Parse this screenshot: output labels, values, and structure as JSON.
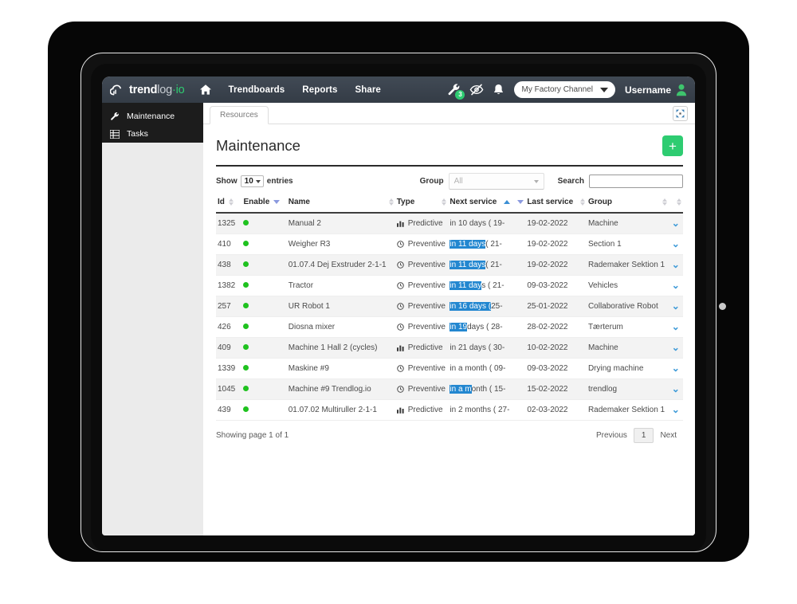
{
  "brand": {
    "logo_part1": "trend",
    "logo_part2": "log",
    "logo_part3": "·io",
    "accent_green": "#2ecc71",
    "navbar_bg": "#3e4651",
    "sidebar_bg": "#1c1c1c"
  },
  "navbar": {
    "home_icon": "home-icon",
    "links": [
      {
        "label": "Trendboards"
      },
      {
        "label": "Reports"
      },
      {
        "label": "Share"
      }
    ],
    "icons": [
      {
        "name": "wrench-icon",
        "badge": "3"
      },
      {
        "name": "eye-slash-icon",
        "badge": ""
      },
      {
        "name": "bell-icon",
        "badge": ""
      }
    ],
    "channel": {
      "label": "My Factory Channel",
      "caret": "chevron-down-icon"
    },
    "user": {
      "label": "Username",
      "icon": "user-icon"
    }
  },
  "sidebar": {
    "items": [
      {
        "label": "Maintenance",
        "icon": "wrench-icon"
      },
      {
        "label": "Tasks",
        "icon": "list-icon"
      }
    ]
  },
  "tabs": {
    "items": [
      {
        "label": "Resources",
        "active": true
      }
    ],
    "expand_icon": "expand-arrows-icon"
  },
  "page": {
    "title": "Maintenance",
    "add_button_label": "+"
  },
  "controls": {
    "show_label": "Show",
    "show_value": "10",
    "entries_label": "entries",
    "group_label": "Group",
    "group_value": "All",
    "search_label": "Search",
    "search_value": "",
    "search_placeholder": ""
  },
  "table": {
    "columns": [
      {
        "label": "Id",
        "sort": "neutral"
      },
      {
        "label": "Enable",
        "sort": "down-light"
      },
      {
        "label": "Name",
        "sort": "neutral"
      },
      {
        "label": "Type",
        "sort": "neutral"
      },
      {
        "label": "Next service",
        "sort": "up-active-down-light"
      },
      {
        "label": "Last service",
        "sort": "neutral"
      },
      {
        "label": "Group",
        "sort": "neutral"
      },
      {
        "label": "",
        "sort": "neutral"
      }
    ],
    "rows": [
      {
        "id": "1325",
        "enable": true,
        "name": "Manual 2",
        "type": "Predictive",
        "type_icon": "bar-chart-icon",
        "next_service": "in 10 days ( 19-",
        "sel_chars": 0,
        "last_service": "19-02-2022",
        "group": "Machine"
      },
      {
        "id": "410",
        "enable": true,
        "name": "Weigher R3",
        "type": "Preventive",
        "type_icon": "clock-icon",
        "next_service": "in 11 days ( 21-",
        "sel_chars": 10,
        "last_service": "19-02-2022",
        "group": "Section 1"
      },
      {
        "id": "438",
        "enable": true,
        "name": "01.07.4 Dej Exstruder 2-1-1",
        "type": "Preventive",
        "type_icon": "clock-icon",
        "next_service": "in 11 days ( 21-",
        "sel_chars": 10,
        "last_service": "19-02-2022",
        "group": "Rademaker Sektion 1"
      },
      {
        "id": "1382",
        "enable": true,
        "name": "Tractor",
        "type": "Preventive",
        "type_icon": "clock-icon",
        "next_service": "in 11 days ( 21-",
        "sel_chars": 9,
        "last_service": "09-03-2022",
        "group": "Vehicles"
      },
      {
        "id": "257",
        "enable": true,
        "name": "UR Robot 1",
        "type": "Preventive",
        "type_icon": "clock-icon",
        "next_service": "in 16 days ( 25-",
        "sel_chars": 12,
        "last_service": "25-01-2022",
        "group": "Collaborative Robot"
      },
      {
        "id": "426",
        "enable": true,
        "name": "Diosna mixer",
        "type": "Preventive",
        "type_icon": "clock-icon",
        "next_service": "in 19 days ( 28-",
        "sel_chars": 5,
        "last_service": "28-02-2022",
        "group": "Tærterum"
      },
      {
        "id": "409",
        "enable": true,
        "name": "Machine 1 Hall 2 (cycles)",
        "type": "Predictive",
        "type_icon": "bar-chart-icon",
        "next_service": "in 21 days ( 30-",
        "sel_chars": 0,
        "last_service": "10-02-2022",
        "group": "Machine"
      },
      {
        "id": "1339",
        "enable": true,
        "name": "Maskine #9",
        "type": "Preventive",
        "type_icon": "clock-icon",
        "next_service": "in a month ( 09-",
        "sel_chars": 0,
        "last_service": "09-03-2022",
        "group": "Drying machine"
      },
      {
        "id": "1045",
        "enable": true,
        "name": "Machine #9 Trendlog.io",
        "type": "Preventive",
        "type_icon": "clock-icon",
        "next_service": "in a month ( 15-",
        "sel_chars": 6,
        "last_service": "15-02-2022",
        "group": "trendlog"
      },
      {
        "id": "439",
        "enable": true,
        "name": "01.07.02 Multiruller 2-1-1",
        "type": "Predictive",
        "type_icon": "bar-chart-icon",
        "next_service": "in 2 months ( 27-",
        "sel_chars": 0,
        "last_service": "02-03-2022",
        "group": "Rademaker Sektion 1"
      }
    ]
  },
  "footer": {
    "showing": "Showing page 1 of 1",
    "previous": "Previous",
    "current_page": "1",
    "next": "Next"
  }
}
